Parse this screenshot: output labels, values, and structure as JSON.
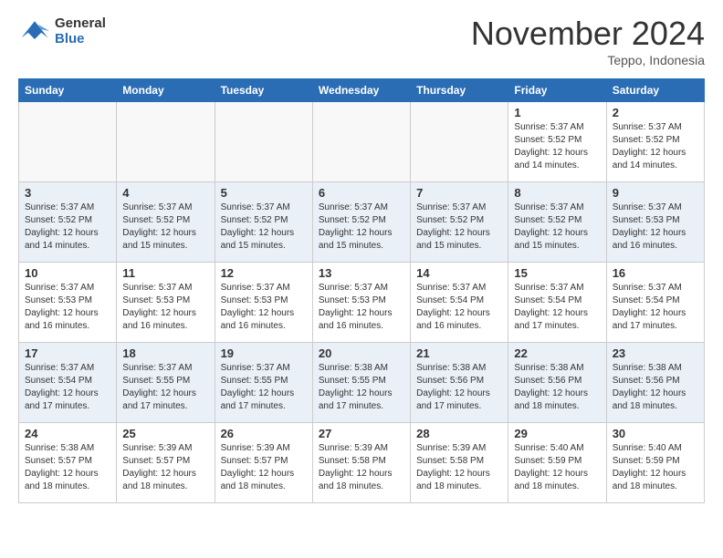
{
  "header": {
    "logo_line1": "General",
    "logo_line2": "Blue",
    "month": "November 2024",
    "location": "Teppo, Indonesia"
  },
  "days_of_week": [
    "Sunday",
    "Monday",
    "Tuesday",
    "Wednesday",
    "Thursday",
    "Friday",
    "Saturday"
  ],
  "weeks": [
    [
      {
        "day": "",
        "info": ""
      },
      {
        "day": "",
        "info": ""
      },
      {
        "day": "",
        "info": ""
      },
      {
        "day": "",
        "info": ""
      },
      {
        "day": "",
        "info": ""
      },
      {
        "day": "1",
        "info": "Sunrise: 5:37 AM\nSunset: 5:52 PM\nDaylight: 12 hours\nand 14 minutes."
      },
      {
        "day": "2",
        "info": "Sunrise: 5:37 AM\nSunset: 5:52 PM\nDaylight: 12 hours\nand 14 minutes."
      }
    ],
    [
      {
        "day": "3",
        "info": "Sunrise: 5:37 AM\nSunset: 5:52 PM\nDaylight: 12 hours\nand 14 minutes."
      },
      {
        "day": "4",
        "info": "Sunrise: 5:37 AM\nSunset: 5:52 PM\nDaylight: 12 hours\nand 15 minutes."
      },
      {
        "day": "5",
        "info": "Sunrise: 5:37 AM\nSunset: 5:52 PM\nDaylight: 12 hours\nand 15 minutes."
      },
      {
        "day": "6",
        "info": "Sunrise: 5:37 AM\nSunset: 5:52 PM\nDaylight: 12 hours\nand 15 minutes."
      },
      {
        "day": "7",
        "info": "Sunrise: 5:37 AM\nSunset: 5:52 PM\nDaylight: 12 hours\nand 15 minutes."
      },
      {
        "day": "8",
        "info": "Sunrise: 5:37 AM\nSunset: 5:52 PM\nDaylight: 12 hours\nand 15 minutes."
      },
      {
        "day": "9",
        "info": "Sunrise: 5:37 AM\nSunset: 5:53 PM\nDaylight: 12 hours\nand 16 minutes."
      }
    ],
    [
      {
        "day": "10",
        "info": "Sunrise: 5:37 AM\nSunset: 5:53 PM\nDaylight: 12 hours\nand 16 minutes."
      },
      {
        "day": "11",
        "info": "Sunrise: 5:37 AM\nSunset: 5:53 PM\nDaylight: 12 hours\nand 16 minutes."
      },
      {
        "day": "12",
        "info": "Sunrise: 5:37 AM\nSunset: 5:53 PM\nDaylight: 12 hours\nand 16 minutes."
      },
      {
        "day": "13",
        "info": "Sunrise: 5:37 AM\nSunset: 5:53 PM\nDaylight: 12 hours\nand 16 minutes."
      },
      {
        "day": "14",
        "info": "Sunrise: 5:37 AM\nSunset: 5:54 PM\nDaylight: 12 hours\nand 16 minutes."
      },
      {
        "day": "15",
        "info": "Sunrise: 5:37 AM\nSunset: 5:54 PM\nDaylight: 12 hours\nand 17 minutes."
      },
      {
        "day": "16",
        "info": "Sunrise: 5:37 AM\nSunset: 5:54 PM\nDaylight: 12 hours\nand 17 minutes."
      }
    ],
    [
      {
        "day": "17",
        "info": "Sunrise: 5:37 AM\nSunset: 5:54 PM\nDaylight: 12 hours\nand 17 minutes."
      },
      {
        "day": "18",
        "info": "Sunrise: 5:37 AM\nSunset: 5:55 PM\nDaylight: 12 hours\nand 17 minutes."
      },
      {
        "day": "19",
        "info": "Sunrise: 5:37 AM\nSunset: 5:55 PM\nDaylight: 12 hours\nand 17 minutes."
      },
      {
        "day": "20",
        "info": "Sunrise: 5:38 AM\nSunset: 5:55 PM\nDaylight: 12 hours\nand 17 minutes."
      },
      {
        "day": "21",
        "info": "Sunrise: 5:38 AM\nSunset: 5:56 PM\nDaylight: 12 hours\nand 17 minutes."
      },
      {
        "day": "22",
        "info": "Sunrise: 5:38 AM\nSunset: 5:56 PM\nDaylight: 12 hours\nand 18 minutes."
      },
      {
        "day": "23",
        "info": "Sunrise: 5:38 AM\nSunset: 5:56 PM\nDaylight: 12 hours\nand 18 minutes."
      }
    ],
    [
      {
        "day": "24",
        "info": "Sunrise: 5:38 AM\nSunset: 5:57 PM\nDaylight: 12 hours\nand 18 minutes."
      },
      {
        "day": "25",
        "info": "Sunrise: 5:39 AM\nSunset: 5:57 PM\nDaylight: 12 hours\nand 18 minutes."
      },
      {
        "day": "26",
        "info": "Sunrise: 5:39 AM\nSunset: 5:57 PM\nDaylight: 12 hours\nand 18 minutes."
      },
      {
        "day": "27",
        "info": "Sunrise: 5:39 AM\nSunset: 5:58 PM\nDaylight: 12 hours\nand 18 minutes."
      },
      {
        "day": "28",
        "info": "Sunrise: 5:39 AM\nSunset: 5:58 PM\nDaylight: 12 hours\nand 18 minutes."
      },
      {
        "day": "29",
        "info": "Sunrise: 5:40 AM\nSunset: 5:59 PM\nDaylight: 12 hours\nand 18 minutes."
      },
      {
        "day": "30",
        "info": "Sunrise: 5:40 AM\nSunset: 5:59 PM\nDaylight: 12 hours\nand 18 minutes."
      }
    ]
  ]
}
